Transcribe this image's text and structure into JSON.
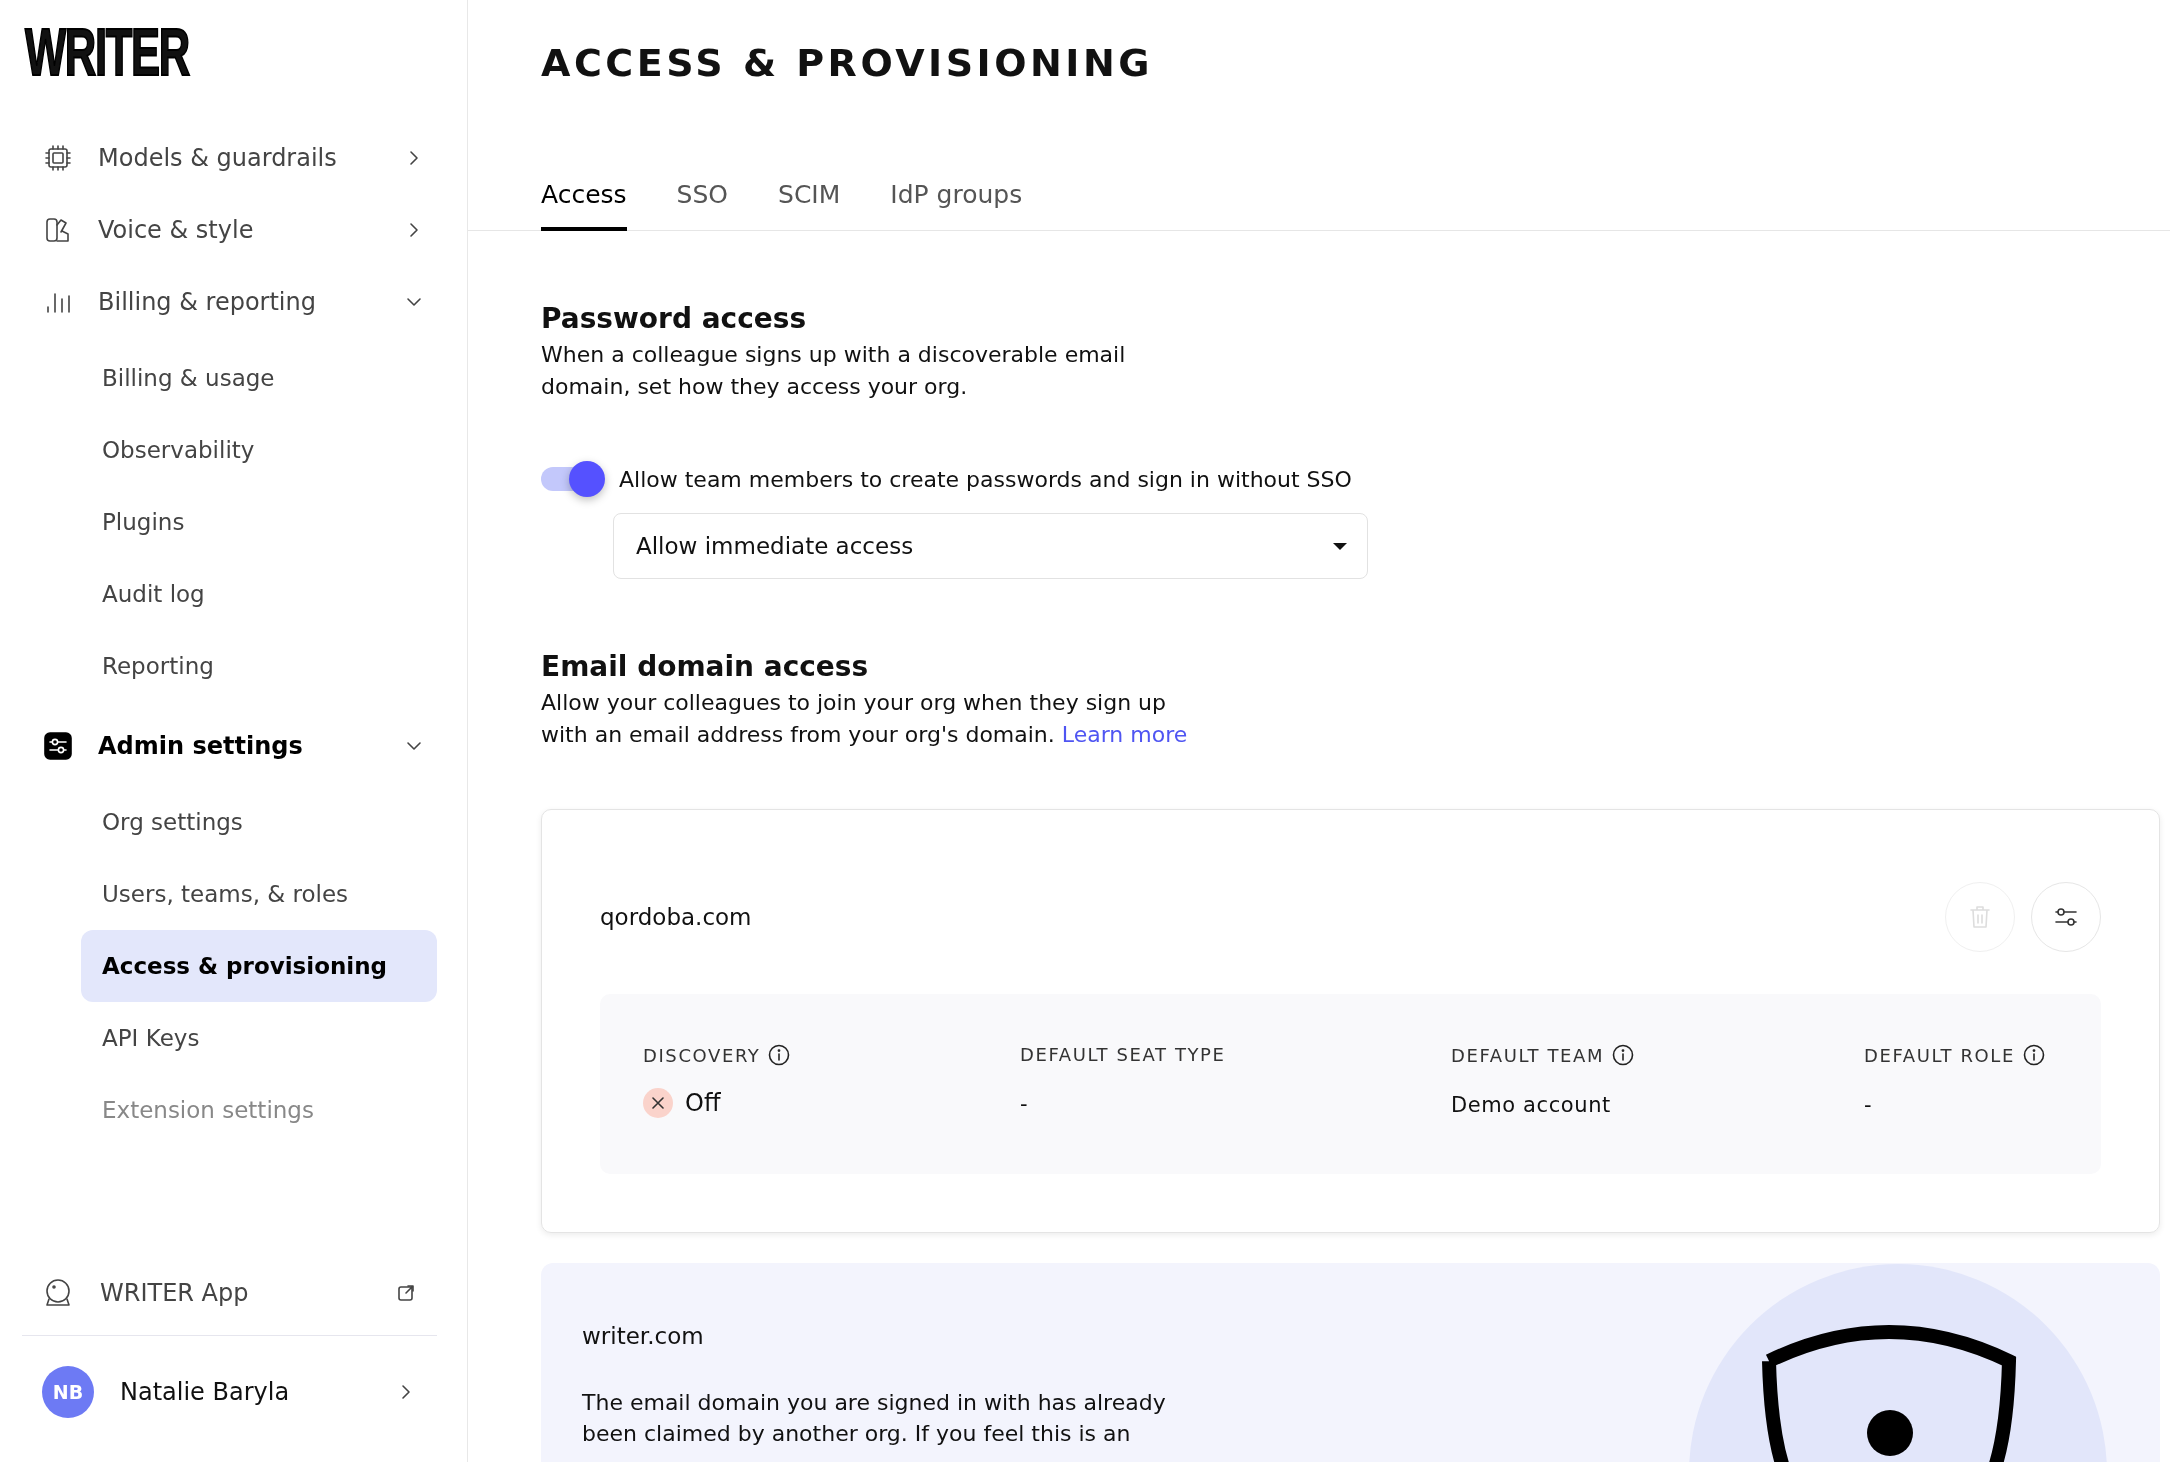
{
  "logo": "WRITER",
  "sidebar": {
    "groups": [
      {
        "label": "Models & guardrails",
        "expanded": false
      },
      {
        "label": "Voice & style",
        "expanded": false
      },
      {
        "label": "Billing & reporting",
        "expanded": true,
        "children": [
          {
            "label": "Billing & usage",
            "selected": false,
            "disabled": false
          },
          {
            "label": "Observability",
            "selected": false,
            "disabled": false
          },
          {
            "label": "Plugins",
            "selected": false,
            "disabled": false
          },
          {
            "label": "Audit log",
            "selected": false,
            "disabled": false
          },
          {
            "label": "Reporting",
            "selected": false,
            "disabled": false
          }
        ]
      },
      {
        "label": "Admin settings",
        "expanded": true,
        "children": [
          {
            "label": "Org settings",
            "selected": false,
            "disabled": false
          },
          {
            "label": "Users, teams, & roles",
            "selected": false,
            "disabled": false
          },
          {
            "label": "Access & provisioning",
            "selected": true,
            "disabled": false
          },
          {
            "label": "API Keys",
            "selected": false,
            "disabled": false
          },
          {
            "label": "Extension settings",
            "selected": false,
            "disabled": true
          }
        ]
      }
    ],
    "app_link": {
      "label": "WRITER App"
    },
    "user": {
      "initials": "NB",
      "name": "Natalie Baryla"
    }
  },
  "page": {
    "title": "ACCESS & PROVISIONING",
    "tabs": [
      {
        "label": "Access",
        "selected": true
      },
      {
        "label": "SSO",
        "selected": false
      },
      {
        "label": "SCIM",
        "selected": false
      },
      {
        "label": "IdP groups",
        "selected": false
      }
    ],
    "password_access": {
      "heading": "Password access",
      "description": "When a colleague signs up with a discoverable email domain, set how they access your org.",
      "toggle": {
        "label": "Allow team members to create passwords and sign in without SSO",
        "on": true
      },
      "select": {
        "value": "Allow immediate access"
      }
    },
    "email_domain_access": {
      "heading": "Email domain access",
      "description": "Allow your colleagues to join your org when they sign up with an email address from your org's domain.",
      "link": "Learn more"
    },
    "domains": [
      {
        "kind": "editable",
        "domain": "qordoba.com",
        "delete_disabled": true,
        "fields": [
          {
            "kind": "status",
            "label": "DISCOVERY",
            "info": true,
            "value": "Off",
            "on": false
          },
          {
            "kind": "text",
            "label": "DEFAULT SEAT TYPE",
            "info": false,
            "value": "-"
          },
          {
            "kind": "text",
            "label": "DEFAULT TEAM",
            "info": true,
            "value": "Demo account"
          },
          {
            "kind": "text",
            "label": "DEFAULT ROLE",
            "info": true,
            "value": "-"
          }
        ]
      },
      {
        "kind": "claimed",
        "domain": "writer.com",
        "message": "The email domain you are signed in with has already been claimed by another org. If you feel this is an"
      }
    ]
  }
}
